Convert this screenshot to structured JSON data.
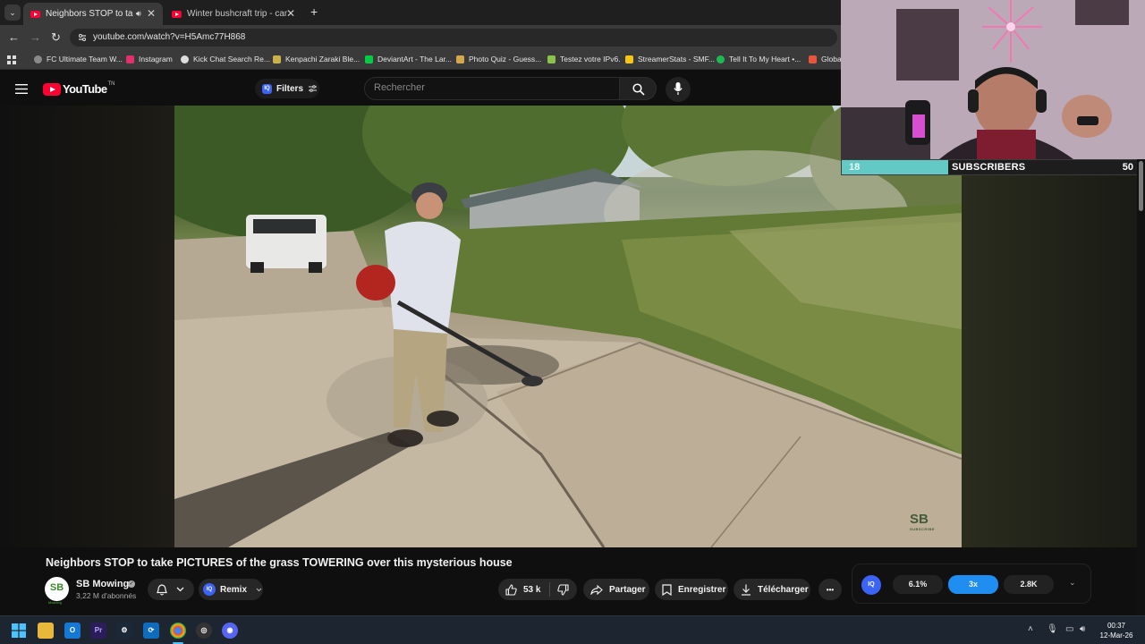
{
  "browser": {
    "tabs": [
      {
        "title": "Neighbors STOP to take PIC",
        "active": true
      },
      {
        "title": "Winter bushcraft trip - canvas h",
        "active": false
      }
    ],
    "new_tab": "+",
    "url": "youtube.com/watch?v=H5Amc77H868"
  },
  "bookmarks": [
    {
      "label": "FC Ultimate Team W...",
      "color": "#8a8a8a"
    },
    {
      "label": "Instagram",
      "color": "#e1306c"
    },
    {
      "label": "Kick Chat Search Re...",
      "color": "#dddddd"
    },
    {
      "label": "Kenpachi Zaraki Ble...",
      "color": "#c9b24a"
    },
    {
      "label": "DeviantArt - The Lar...",
      "color": "#05cc47"
    },
    {
      "label": "Photo Quiz - Guess...",
      "color": "#d4a84a"
    },
    {
      "label": "Testez votre IPv6.",
      "color": "#8bc34a"
    },
    {
      "label": "StreamerStats - SMF...",
      "color": "#f5c518"
    },
    {
      "label": "Tell It To My Heart •...",
      "color": "#1db954"
    },
    {
      "label": "Globa",
      "color": "#e8553a"
    }
  ],
  "youtube": {
    "logo_text": "YouTube",
    "logo_suffix": "TN",
    "filters_label": "Filters",
    "search_placeholder": "Rechercher"
  },
  "video": {
    "title": "Neighbors STOP to take PICTURES of the grass TOWERING over this mysterious house",
    "watermark": "SB",
    "watermark_sub": "SUBSCRIBE"
  },
  "channel": {
    "avatar_text": "SB",
    "avatar_sub": "Mowing",
    "name": "SB Mowing",
    "subscribers": "3,22 M d'abonnés"
  },
  "actions": {
    "remix": "Remix",
    "likes": "53 k",
    "share": "Partager",
    "save": "Enregistrer",
    "download": "Télécharger",
    "more": "•••"
  },
  "stream_overlay": {
    "subscribers_current": "18",
    "subscribers_label": "SUBSCRIBERS",
    "subscribers_goal": "50",
    "progress": 0.36
  },
  "extension": {
    "badge": "IQ",
    "stat1": "6.1%",
    "speed": "3x",
    "stat2": "2.8K"
  },
  "taskbar": {
    "time": "00:37",
    "date": "12-Mar-26"
  },
  "colors": {
    "youtube_red": "#ff0033",
    "accent_blue": "#1f8ef0",
    "subscriber_bar": "#63c9c4"
  }
}
